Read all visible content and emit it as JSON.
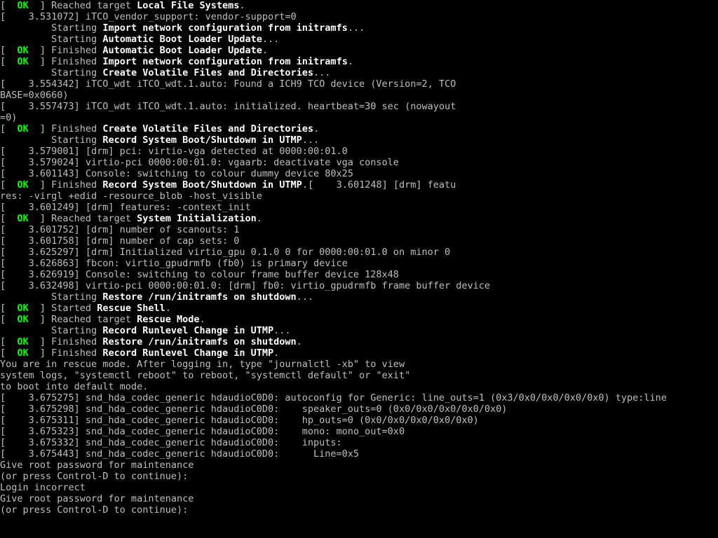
{
  "colors": {
    "background": "#000000",
    "foreground": "#bfbfbf",
    "ok_green": "#00ff00",
    "bold_white": "#ffffff"
  },
  "prompt_cursor": "",
  "lines": [
    [
      {
        "c": "gray",
        "t": "[  "
      },
      {
        "c": "ok",
        "t": "OK"
      },
      {
        "c": "gray",
        "t": "  ] Reached target "
      },
      {
        "c": "white",
        "t": "Local File Systems"
      },
      {
        "c": "gray",
        "t": "."
      }
    ],
    [
      {
        "c": "gray",
        "t": "[    3.531072] iTCO_vendor_support: vendor-support=0"
      }
    ],
    [
      {
        "c": "gray",
        "t": "         Starting "
      },
      {
        "c": "white",
        "t": "Import network configuration from initramfs"
      },
      {
        "c": "gray",
        "t": "..."
      }
    ],
    [
      {
        "c": "gray",
        "t": "         Starting "
      },
      {
        "c": "white",
        "t": "Automatic Boot Loader Update"
      },
      {
        "c": "gray",
        "t": "..."
      }
    ],
    [
      {
        "c": "gray",
        "t": "[  "
      },
      {
        "c": "ok",
        "t": "OK"
      },
      {
        "c": "gray",
        "t": "  ] Finished "
      },
      {
        "c": "white",
        "t": "Automatic Boot Loader Update"
      },
      {
        "c": "gray",
        "t": "."
      }
    ],
    [
      {
        "c": "gray",
        "t": "[  "
      },
      {
        "c": "ok",
        "t": "OK"
      },
      {
        "c": "gray",
        "t": "  ] Finished "
      },
      {
        "c": "white",
        "t": "Import network configuration from initramfs"
      },
      {
        "c": "gray",
        "t": "."
      }
    ],
    [
      {
        "c": "gray",
        "t": "         Starting "
      },
      {
        "c": "white",
        "t": "Create Volatile Files and Directories"
      },
      {
        "c": "gray",
        "t": "..."
      }
    ],
    [
      {
        "c": "gray",
        "t": "[    3.554342] iTCO_wdt iTCO_wdt.1.auto: Found a ICH9 TCO device (Version=2, TCO"
      }
    ],
    [
      {
        "c": "gray",
        "t": "BASE=0x0660)"
      }
    ],
    [
      {
        "c": "gray",
        "t": "[    3.557473] iTCO_wdt iTCO_wdt.1.auto: initialized. heartbeat=30 sec (nowayout"
      }
    ],
    [
      {
        "c": "gray",
        "t": "=0)"
      }
    ],
    [
      {
        "c": "gray",
        "t": "[  "
      },
      {
        "c": "ok",
        "t": "OK"
      },
      {
        "c": "gray",
        "t": "  ] Finished "
      },
      {
        "c": "white",
        "t": "Create Volatile Files and Directories"
      },
      {
        "c": "gray",
        "t": "."
      }
    ],
    [
      {
        "c": "gray",
        "t": "         Starting "
      },
      {
        "c": "white",
        "t": "Record System Boot/Shutdown in UTMP"
      },
      {
        "c": "gray",
        "t": "..."
      }
    ],
    [
      {
        "c": "gray",
        "t": "[    3.579001] [drm] pci: virtio-vga detected at 0000:00:01.0"
      }
    ],
    [
      {
        "c": "gray",
        "t": "[    3.579024] virtio-pci 0000:00:01.0: vgaarb: deactivate vga console"
      }
    ],
    [
      {
        "c": "gray",
        "t": "[    3.601143] Console: switching to colour dummy device 80x25"
      }
    ],
    [
      {
        "c": "gray",
        "t": "[  "
      },
      {
        "c": "ok",
        "t": "OK"
      },
      {
        "c": "gray",
        "t": "  ] Finished "
      },
      {
        "c": "white",
        "t": "Record System Boot/Shutdown in UTMP"
      },
      {
        "c": "gray",
        "t": ".[    3.601248] [drm] featu"
      }
    ],
    [
      {
        "c": "gray",
        "t": "res: -virgl +edid -resource_blob -host_visible"
      }
    ],
    [
      {
        "c": "gray",
        "t": "[    3.601249] [drm] features: -context_init"
      }
    ],
    [
      {
        "c": "gray",
        "t": ""
      }
    ],
    [
      {
        "c": "gray",
        "t": "[  "
      },
      {
        "c": "ok",
        "t": "OK"
      },
      {
        "c": "gray",
        "t": "  ] Reached target "
      },
      {
        "c": "white",
        "t": "System Initialization"
      },
      {
        "c": "gray",
        "t": "."
      }
    ],
    [
      {
        "c": "gray",
        "t": "[    3.601752] [drm] number of scanouts: 1"
      }
    ],
    [
      {
        "c": "gray",
        "t": "[    3.601758] [drm] number of cap sets: 0"
      }
    ],
    [
      {
        "c": "gray",
        "t": "[    3.625297] [drm] Initialized virtio_gpu 0.1.0 0 for 0000:00:01.0 on minor 0"
      }
    ],
    [
      {
        "c": "gray",
        "t": "[    3.626863] fbcon: virtio_gpudrmfb (fb0) is primary device"
      }
    ],
    [
      {
        "c": "gray",
        "t": "[    3.626919] Console: switching to colour frame buffer device 128x48"
      }
    ],
    [
      {
        "c": "gray",
        "t": "[    3.632498] virtio-pci 0000:00:01.0: [drm] fb0: virtio_gpudrmfb frame buffer device"
      }
    ],
    [
      {
        "c": "gray",
        "t": "         Starting "
      },
      {
        "c": "white",
        "t": "Restore /run/initramfs on shutdown"
      },
      {
        "c": "gray",
        "t": "..."
      }
    ],
    [
      {
        "c": "gray",
        "t": "[  "
      },
      {
        "c": "ok",
        "t": "OK"
      },
      {
        "c": "gray",
        "t": "  ] Started "
      },
      {
        "c": "white",
        "t": "Rescue Shell"
      },
      {
        "c": "gray",
        "t": "."
      }
    ],
    [
      {
        "c": "gray",
        "t": "[  "
      },
      {
        "c": "ok",
        "t": "OK"
      },
      {
        "c": "gray",
        "t": "  ] Reached target "
      },
      {
        "c": "white",
        "t": "Rescue Mode"
      },
      {
        "c": "gray",
        "t": "."
      }
    ],
    [
      {
        "c": "gray",
        "t": "         Starting "
      },
      {
        "c": "white",
        "t": "Record Runlevel Change in UTMP"
      },
      {
        "c": "gray",
        "t": "..."
      }
    ],
    [
      {
        "c": "gray",
        "t": "[  "
      },
      {
        "c": "ok",
        "t": "OK"
      },
      {
        "c": "gray",
        "t": "  ] Finished "
      },
      {
        "c": "white",
        "t": "Restore /run/initramfs on shutdown"
      },
      {
        "c": "gray",
        "t": "."
      }
    ],
    [
      {
        "c": "gray",
        "t": "[  "
      },
      {
        "c": "ok",
        "t": "OK"
      },
      {
        "c": "gray",
        "t": "  ] Finished "
      },
      {
        "c": "white",
        "t": "Record Runlevel Change in UTMP"
      },
      {
        "c": "gray",
        "t": "."
      }
    ],
    [
      {
        "c": "gray",
        "t": "You are in rescue mode. After logging in, type \"journalctl -xb\" to view"
      }
    ],
    [
      {
        "c": "gray",
        "t": "system logs, \"systemctl reboot\" to reboot, \"systemctl default\" or \"exit\""
      }
    ],
    [
      {
        "c": "gray",
        "t": "to boot into default mode."
      }
    ],
    [
      {
        "c": "gray",
        "t": "[    3.675275] snd_hda_codec_generic hdaudioC0D0: autoconfig for Generic: line_outs=1 (0x3/0x0/0x0/0x0/0x0) type:line"
      }
    ],
    [
      {
        "c": "gray",
        "t": "[    3.675298] snd_hda_codec_generic hdaudioC0D0:    speaker_outs=0 (0x0/0x0/0x0/0x0/0x0)"
      }
    ],
    [
      {
        "c": "gray",
        "t": "[    3.675311] snd_hda_codec_generic hdaudioC0D0:    hp_outs=0 (0x0/0x0/0x0/0x0/0x0)"
      }
    ],
    [
      {
        "c": "gray",
        "t": "[    3.675323] snd_hda_codec_generic hdaudioC0D0:    mono: mono_out=0x0"
      }
    ],
    [
      {
        "c": "gray",
        "t": "[    3.675332] snd_hda_codec_generic hdaudioC0D0:    inputs:"
      }
    ],
    [
      {
        "c": "gray",
        "t": "[    3.675443] snd_hda_codec_generic hdaudioC0D0:      Line=0x5"
      }
    ],
    [
      {
        "c": "gray",
        "t": "Give root password for maintenance"
      }
    ],
    [
      {
        "c": "gray",
        "t": "(or press Control-D to continue): "
      }
    ],
    [
      {
        "c": "gray",
        "t": "Login incorrect"
      }
    ],
    [
      {
        "c": "gray",
        "t": ""
      }
    ],
    [
      {
        "c": "gray",
        "t": "Give root password for maintenance"
      }
    ],
    [
      {
        "c": "gray",
        "t": "(or press Control-D to continue): "
      }
    ]
  ]
}
